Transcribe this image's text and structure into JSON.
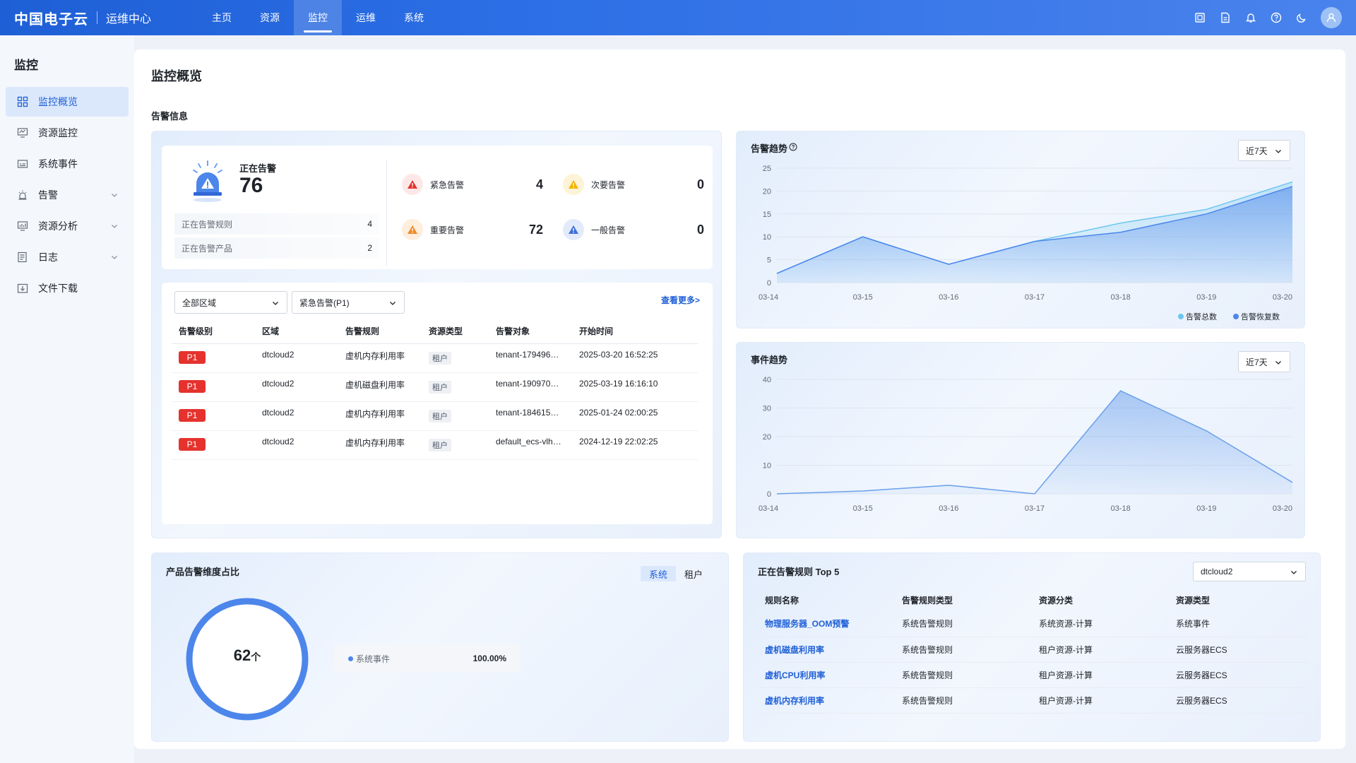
{
  "header": {
    "brand": "中国电子云",
    "subtitle": "运维中心",
    "nav": [
      "主页",
      "资源",
      "监控",
      "运维",
      "系统"
    ],
    "active_nav": 2
  },
  "sidebar": {
    "title": "监控",
    "items": [
      {
        "label": "监控概览",
        "icon": "grid-icon",
        "active": true
      },
      {
        "label": "资源监控",
        "icon": "monitor-icon"
      },
      {
        "label": "系统事件",
        "icon": "event-icon"
      },
      {
        "label": "告警",
        "icon": "alarm-icon",
        "expand": true
      },
      {
        "label": "资源分析",
        "icon": "analysis-icon",
        "expand": true
      },
      {
        "label": "日志",
        "icon": "log-icon",
        "expand": true
      },
      {
        "label": "文件下载",
        "icon": "download-icon"
      }
    ]
  },
  "page": {
    "title": "监控概览",
    "section": "告警信息"
  },
  "alarm_summary": {
    "label": "正在告警",
    "total": "76",
    "rules_label": "正在告警规则",
    "rules_value": "4",
    "products_label": "正在告警产品",
    "products_value": "2",
    "levels": [
      {
        "label": "紧急告警",
        "value": "4",
        "color": "#e5322d"
      },
      {
        "label": "次要告警",
        "value": "0",
        "color": "#f5b400"
      },
      {
        "label": "重要告警",
        "value": "72",
        "color": "#f08a24"
      },
      {
        "label": "一般告警",
        "value": "0",
        "color": "#3f6fd8"
      }
    ]
  },
  "alarm_list": {
    "region_select": "全部区域",
    "level_select": "紧急告警(P1)",
    "more": "查看更多>",
    "columns": [
      "告警级别",
      "区域",
      "告警规则",
      "资源类型",
      "告警对象",
      "开始时间"
    ],
    "rows": [
      {
        "level": "P1",
        "region": "dtcloud2",
        "rule": "虚机内存利用率",
        "type": "租户",
        "target": "tenant-179496…",
        "time": "2025-03-20 16:52:25"
      },
      {
        "level": "P1",
        "region": "dtcloud2",
        "rule": "虚机磁盘利用率",
        "type": "租户",
        "target": "tenant-190970…",
        "time": "2025-03-19 16:16:10"
      },
      {
        "level": "P1",
        "region": "dtcloud2",
        "rule": "虚机内存利用率",
        "type": "租户",
        "target": "tenant-184615…",
        "time": "2025-01-24 02:00:25"
      },
      {
        "level": "P1",
        "region": "dtcloud2",
        "rule": "虚机内存利用率",
        "type": "租户",
        "target": "default_ecs-vlh…",
        "time": "2024-12-19 22:02:25"
      }
    ]
  },
  "alarm_trend": {
    "title": "告警趋势",
    "range": "近7天"
  },
  "event_trend": {
    "title": "事件趋势",
    "range": "近7天"
  },
  "chart_data": [
    {
      "type": "area",
      "title": "告警趋势",
      "x": [
        "03-14",
        "03-15",
        "03-16",
        "03-17",
        "03-18",
        "03-19",
        "03-20"
      ],
      "ylim": [
        0,
        25
      ],
      "yticks": [
        0,
        5,
        10,
        15,
        20,
        25
      ],
      "series": [
        {
          "name": "告警总数",
          "values": [
            2,
            10,
            4,
            9,
            13,
            16,
            22
          ],
          "color": "#6ec6f0"
        },
        {
          "name": "告警恢复数",
          "values": [
            2,
            10,
            4,
            9,
            11,
            15,
            21
          ],
          "color": "#4c86ea"
        }
      ],
      "legend": "bottom-right",
      "grid": true
    },
    {
      "type": "area",
      "title": "事件趋势",
      "x": [
        "03-14",
        "03-15",
        "03-16",
        "03-17",
        "03-18",
        "03-19",
        "03-20"
      ],
      "ylim": [
        0,
        40
      ],
      "yticks": [
        0,
        10,
        20,
        30,
        40
      ],
      "series": [
        {
          "values": [
            0,
            1,
            3,
            0,
            36,
            22,
            4
          ],
          "color": "#6aa0ec"
        }
      ],
      "grid": true
    }
  ],
  "product_ratio": {
    "title": "产品告警维度占比",
    "tabs": [
      "系统",
      "租户"
    ],
    "active_tab": 0,
    "total": "62",
    "unit": "个",
    "items": [
      {
        "name": "系统事件",
        "pct": "100.00%",
        "fraction": 1.0
      }
    ]
  },
  "top_rules": {
    "title": "正在告警规则 Top 5",
    "region": "dtcloud2",
    "columns": [
      "规则名称",
      "告警规则类型",
      "资源分类",
      "资源类型"
    ],
    "rows": [
      {
        "name": "物理服务器_OOM预警",
        "rtype": "系统告警规则",
        "cat": "系统资源-计算",
        "res": "系统事件"
      },
      {
        "name": "虚机磁盘利用率",
        "rtype": "系统告警规则",
        "cat": "租户资源-计算",
        "res": "云服务器ECS"
      },
      {
        "name": "虚机CPU利用率",
        "rtype": "系统告警规则",
        "cat": "租户资源-计算",
        "res": "云服务器ECS"
      },
      {
        "name": "虚机内存利用率",
        "rtype": "系统告警规则",
        "cat": "租户资源-计算",
        "res": "云服务器ECS"
      }
    ]
  }
}
